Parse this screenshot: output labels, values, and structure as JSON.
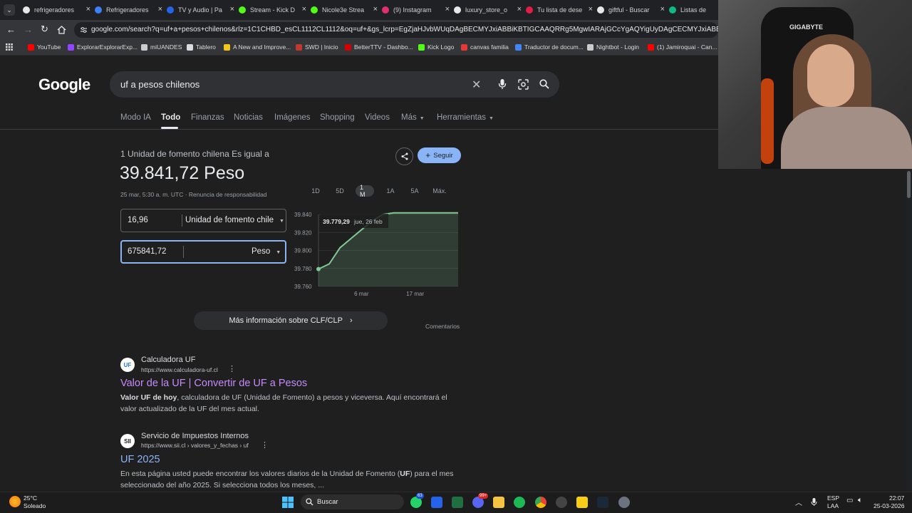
{
  "browser": {
    "tabs": [
      {
        "label": "refrigeradores",
        "color": "#e8e8e8"
      },
      {
        "label": "Refrigeradores",
        "color": "#3b82f6"
      },
      {
        "label": "TV y Audio | Pa",
        "color": "#2563eb"
      },
      {
        "label": "Stream - Kick D",
        "color": "#53fc18"
      },
      {
        "label": "Nicole3e Strea",
        "color": "#53fc18"
      },
      {
        "label": "(9) Instagram",
        "color": "#e1306c"
      },
      {
        "label": "luxury_store_o",
        "color": "#e8e8e8"
      },
      {
        "label": "Tu lista de dese",
        "color": "#e11d48"
      },
      {
        "label": "giftful - Buscar",
        "color": "#e8e8e8"
      },
      {
        "label": "Listas de desec",
        "color": "#10b981"
      }
    ],
    "url": "google.com/search?q=uf+a+pesos+chilenos&rlz=1C1CHBD_esCL1112CL1112&oq=uf+&gs_lcrp=EgZjaHJvbWUqDAgBECMYJxiABBiKBTIGCAAQRRg5MgwIARAjGCcYgAQYigUyDAgCECMYJxiABBiKBTIPCAMQABhDGL",
    "bookmarks": [
      {
        "label": "YouTube",
        "color": "#ff0000"
      },
      {
        "label": "ExplorarExplorarExp...",
        "color": "#9146ff"
      },
      {
        "label": "miUANDES",
        "color": "#cccccc"
      },
      {
        "label": "Tablero",
        "color": "#dddddd"
      },
      {
        "label": "A New and Improve...",
        "color": "#f5c518"
      },
      {
        "label": "SWD | Inicio",
        "color": "#c0392b"
      },
      {
        "label": "BetterTTV - Dashbo...",
        "color": "#d50000"
      },
      {
        "label": "Kick Logo",
        "color": "#53fc18"
      },
      {
        "label": "canvas familia",
        "color": "#e53935"
      },
      {
        "label": "Traductor de docum...",
        "color": "#4285f4"
      },
      {
        "label": "Nightbot - Login",
        "color": "#cccccc"
      },
      {
        "label": "(1) Jamiroquai - Can...",
        "color": "#ff0000"
      }
    ]
  },
  "google": {
    "logo": "Google",
    "query": "uf a pesos chilenos",
    "tabs": [
      "Modo IA",
      "Todo",
      "Finanzas",
      "Noticias",
      "Imágenes",
      "Shopping",
      "Videos",
      "Más",
      "Herramientas"
    ],
    "converter": {
      "description": "1 Unidad de fomento chilena Es igual a",
      "result": "39.841,72 Peso",
      "timestamp": "25 mar, 5:30 a. m. UTC · Renuncia de responsabilidad",
      "follow_label": "Seguir",
      "from_value": "16,96",
      "from_unit": "Unidad de fomento chile",
      "to_value": "675841,72",
      "to_unit": "Peso",
      "ranges": [
        "1D",
        "5D",
        "1 M",
        "1A",
        "5A",
        "Máx."
      ],
      "active_range": "1 M",
      "tooltip_value": "39.779,29",
      "tooltip_date": "jue, 26 feb",
      "more_info": "Más información sobre CLF/CLP",
      "feedback": "Comentarios"
    },
    "chart_data": {
      "type": "line",
      "x": [
        "26 feb",
        "27 feb",
        "2 mar",
        "4 mar",
        "6 mar",
        "9 mar",
        "11 mar",
        "13 mar",
        "16 mar",
        "17 mar",
        "19 mar",
        "21 mar",
        "23 mar",
        "25 mar"
      ],
      "values": [
        39779.29,
        39785,
        39803,
        39813,
        39823,
        39833,
        39840,
        39841.72,
        39841.72,
        39841.72,
        39841.72,
        39841.72,
        39841.72,
        39841.72
      ],
      "yticks": [
        "39.840",
        "39.820",
        "39.800",
        "39.780",
        "39.760"
      ],
      "ytick_values": [
        39840,
        39820,
        39800,
        39780,
        39760
      ],
      "xticks": [
        "6 mar",
        "17 mar"
      ],
      "ylim": [
        39760,
        39840
      ],
      "grid": true,
      "color": "#81c995"
    },
    "results": [
      {
        "site": "Calculadora UF",
        "url": "https://www.calculadora-uf.cl",
        "favicon": "UF",
        "title": "Valor de la UF | Convertir de UF a Pesos",
        "title_color": "#c58af9",
        "snippet_bold": "Valor UF de hoy",
        "snippet": ", calculadora de UF (Unidad de Fomento) a pesos y viceversa. Aquí encontrará el valor actualizado de la UF del mes actual."
      },
      {
        "site": "Servicio de Impuestos Internos",
        "url": "https://www.sii.cl › valores_y_fechas › uf",
        "favicon": "SII",
        "title": "UF 2025",
        "title_color": "#8ab4f8",
        "snippet_pre": "En esta página usted puede encontrar los valores diarios de la Unidad de Fomento (",
        "snippet_bold": "UF",
        "snippet": ") para el mes seleccionado del año 2025. Si selecciona todos los meses, ..."
      }
    ]
  },
  "webcam": {
    "brand": "GIGABYTE"
  },
  "taskbar": {
    "weather_temp": "25°C",
    "weather_desc": "Soleado",
    "search_label": "Buscar",
    "lang": "ESP",
    "lang2": "LAA",
    "time": "22:07",
    "date": "25-03-2026",
    "whatsapp_badge": "63",
    "discord_badge": "99+"
  }
}
